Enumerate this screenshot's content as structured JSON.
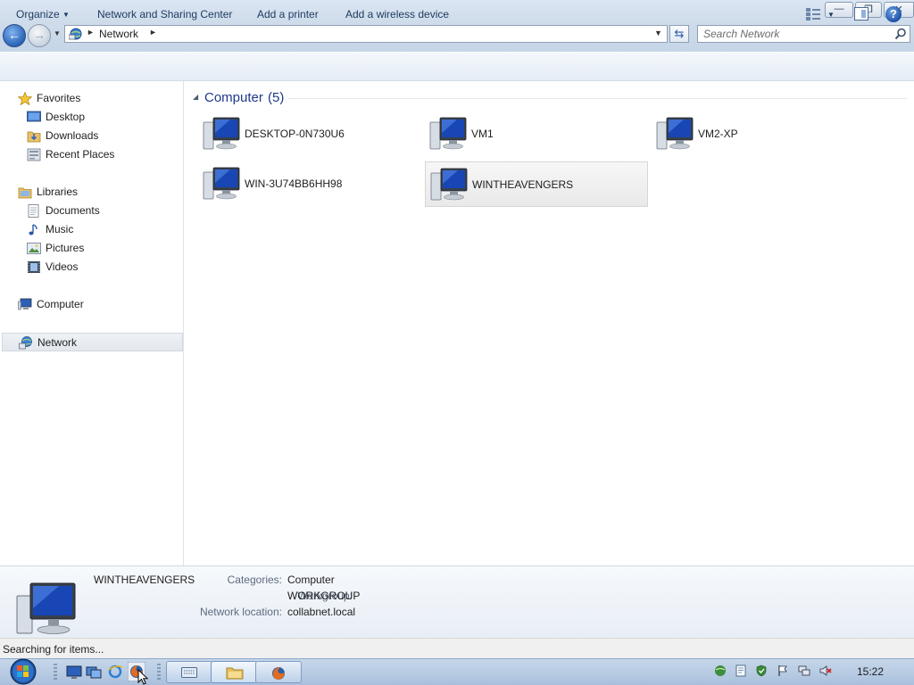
{
  "window": {
    "title_buttons": {
      "minimize": "—",
      "maximize": "❐",
      "close": "✕"
    }
  },
  "nav_buttons": {
    "back": "←",
    "forward": "→",
    "recent": "▼"
  },
  "address": {
    "separator": "►",
    "location": "Network",
    "dropdown": "▼",
    "refresh": "⇆"
  },
  "search": {
    "placeholder": "Search Network"
  },
  "commandbar": {
    "organize": "Organize",
    "organize_arrow": "▼",
    "network_sharing": "Network and Sharing Center",
    "add_printer": "Add a printer",
    "add_wireless": "Add a wireless device",
    "views_arrow": "▼",
    "help": "?"
  },
  "navpane": {
    "favorites": "Favorites",
    "desktop": "Desktop",
    "downloads": "Downloads",
    "recent_places": "Recent Places",
    "libraries": "Libraries",
    "documents": "Documents",
    "music": "Music",
    "pictures": "Pictures",
    "videos": "Videos",
    "computer": "Computer",
    "network": "Network"
  },
  "content": {
    "group_arrow": "◢",
    "group_title": "Computer",
    "group_count": "(5)",
    "computers": [
      {
        "name": "DESKTOP-0N730U6"
      },
      {
        "name": "VM1"
      },
      {
        "name": "VM2-XP"
      },
      {
        "name": "WIN-3U74BB6HH98"
      },
      {
        "name": "WINTHEAVENGERS"
      }
    ]
  },
  "details": {
    "name": "WINTHEAVENGERS",
    "categories_label": "Categories:",
    "categories_value": "Computer",
    "workgroup_label": "Workgroup:",
    "workgroup_value": "WORKGROUP",
    "location_label": "Network location:",
    "location_value": "collabnet.local"
  },
  "status": {
    "text": "Searching for items..."
  },
  "taskbar": {
    "clock": "15:22"
  }
}
